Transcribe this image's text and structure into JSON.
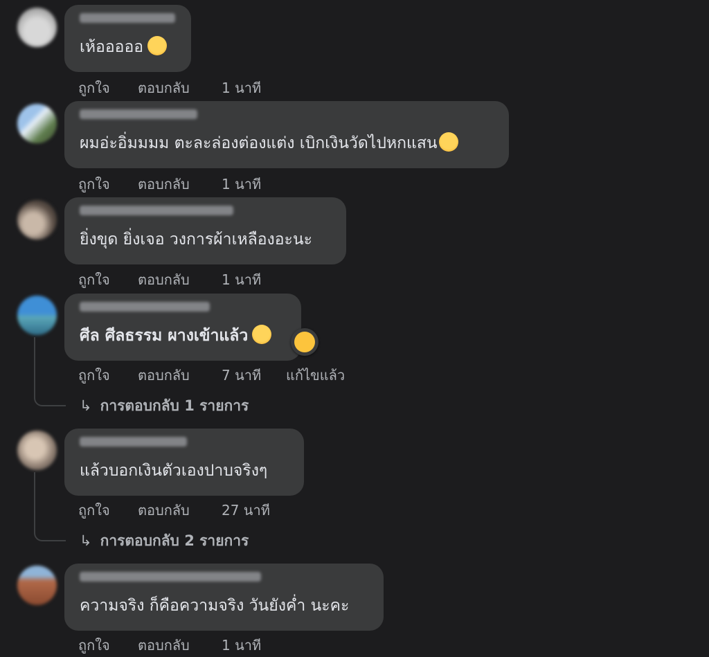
{
  "actions": {
    "like": "ถูกใจ",
    "reply": "ตอบกลับ"
  },
  "comments": [
    {
      "text": "เห้อออออ",
      "emoji": "pensive-face-emoji",
      "time": "1 นาที",
      "edited": "",
      "replies": ""
    },
    {
      "text": "ผมอ่ะอิ่มมมม ตะละล่องต่องแต่ง เบิกเงินวัดไปหกแสน",
      "emoji": "grinning-sweat-emoji",
      "time": "1 นาที",
      "edited": "",
      "replies": ""
    },
    {
      "text": "ยิ่งขุด ยิ่งเจอ วงการผ้าเหลืองอะนะ",
      "emoji": "",
      "time": "1 นาที",
      "edited": "",
      "replies": ""
    },
    {
      "text": "ศีล ศีลธรรม ผางเข้าแล้ว",
      "emoji": "rolling-laughing-emoji",
      "reaction": "laughing-reaction-icon",
      "time": "7 นาที",
      "edited": "แก้ไขแล้ว",
      "replies": "การตอบกลับ 1 รายการ"
    },
    {
      "text": "แล้วบอกเงินตัวเองปาบจริงๆ",
      "emoji": "",
      "time": "27 นาที",
      "edited": "",
      "replies": "การตอบกลับ 2 รายการ"
    },
    {
      "text": "ความจริง ก็คือความจริง วันยังค่ำ นะคะ",
      "emoji": "",
      "time": "1 นาที",
      "edited": "",
      "replies": ""
    }
  ],
  "colors": {
    "background": "#1c1c1e",
    "bubble": "#3a3b3c",
    "primary_text": "#e4e6eb",
    "secondary_text": "#b0b3b8",
    "emoji_yellow": "#fcc43d"
  }
}
